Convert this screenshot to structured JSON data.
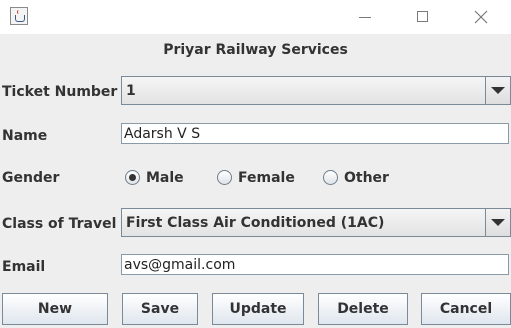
{
  "window": {
    "icon": "java-cup-icon",
    "controls": [
      "minimize-icon",
      "maximize-icon",
      "close-icon"
    ]
  },
  "form": {
    "title": "Priyar Railway Services",
    "ticket_number": {
      "label": "Ticket Number",
      "value": "1"
    },
    "name": {
      "label": "Name",
      "value": "Adarsh V S"
    },
    "gender": {
      "label": "Gender",
      "options": [
        "Male",
        "Female",
        "Other"
      ],
      "selected": "Male"
    },
    "class_of_travel": {
      "label": "Class of Travel",
      "value": "First Class Air Conditioned (1AC)"
    },
    "email": {
      "label": "Email",
      "value": "avs@gmail.com"
    }
  },
  "buttons": {
    "new": "New",
    "save": "Save",
    "update": "Update",
    "delete": "Delete",
    "cancel": "Cancel"
  }
}
